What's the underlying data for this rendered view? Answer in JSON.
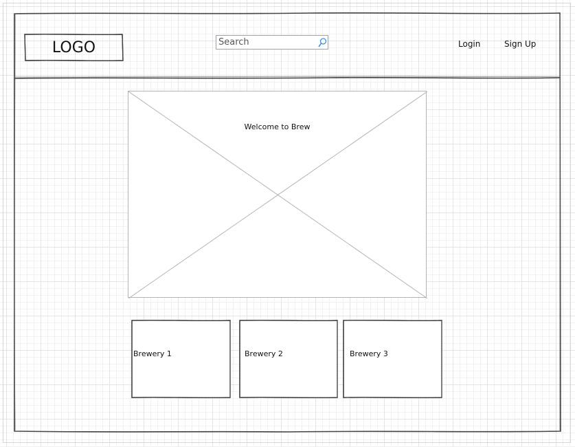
{
  "header": {
    "logo_text": "LOGO",
    "search": {
      "placeholder": "Search",
      "value": "",
      "icon": "search-icon"
    },
    "nav": {
      "login_label": "Login",
      "signup_label": "Sign Up"
    }
  },
  "hero": {
    "title": "Welcome to Brew",
    "image_icon": "image-placeholder-icon"
  },
  "breweries": [
    {
      "label": "Brewery 1"
    },
    {
      "label": "Brewery 2"
    },
    {
      "label": "Brewery 3"
    }
  ],
  "colors": {
    "sketch_line": "#444444",
    "grid_major": "#e4e4e4",
    "grid_minor": "#f1f1f1",
    "placeholder_line": "#b3b3b3",
    "search_border": "#9aa3ad",
    "search_icon": "#3a8ed6"
  }
}
